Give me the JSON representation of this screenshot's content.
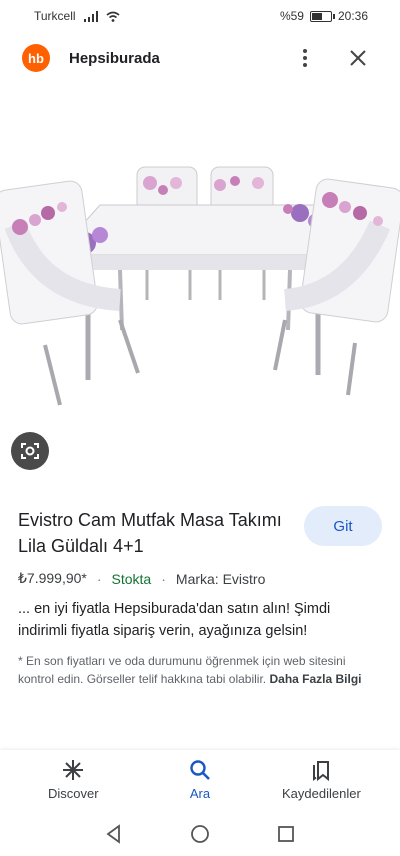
{
  "status_bar": {
    "carrier": "Turkcell",
    "battery": "%59",
    "battery_level": 0.59,
    "time": "20:36"
  },
  "header": {
    "logo_text": "hb",
    "site_name": "Hepsiburada",
    "more_icon": "more-vert-icon",
    "close_icon": "close-icon"
  },
  "colors": {
    "brand": "#ff6000",
    "accent": "#1a56c4",
    "stock": "#137333"
  },
  "product": {
    "title": "Evistro Cam Mutfak Masa Takımı Lila Güldalı 4+1",
    "go_button": "Git",
    "price": "₺7.999,90*",
    "stock": "Stokta",
    "separator": "·",
    "brand": "Marka: Evistro",
    "description": "... en iyi fiyatla Hepsiburada'dan satın alın! Şimdi indirimli fiyatla sipariş verin, ayağınıza gelsin!",
    "note": "* En son fiyatları ve oda durumunu öğrenmek için web sitesini kontrol edin. Görseller telif hakkına tabi olabilir.",
    "more_info": "Daha Fazla Bilgi"
  },
  "bottom_nav": {
    "items": [
      {
        "label": "Discover",
        "icon": "asterisk-icon"
      },
      {
        "label": "Ara",
        "icon": "search-icon"
      },
      {
        "label": "Kaydedilenler",
        "icon": "bookmarks-icon"
      }
    ]
  }
}
